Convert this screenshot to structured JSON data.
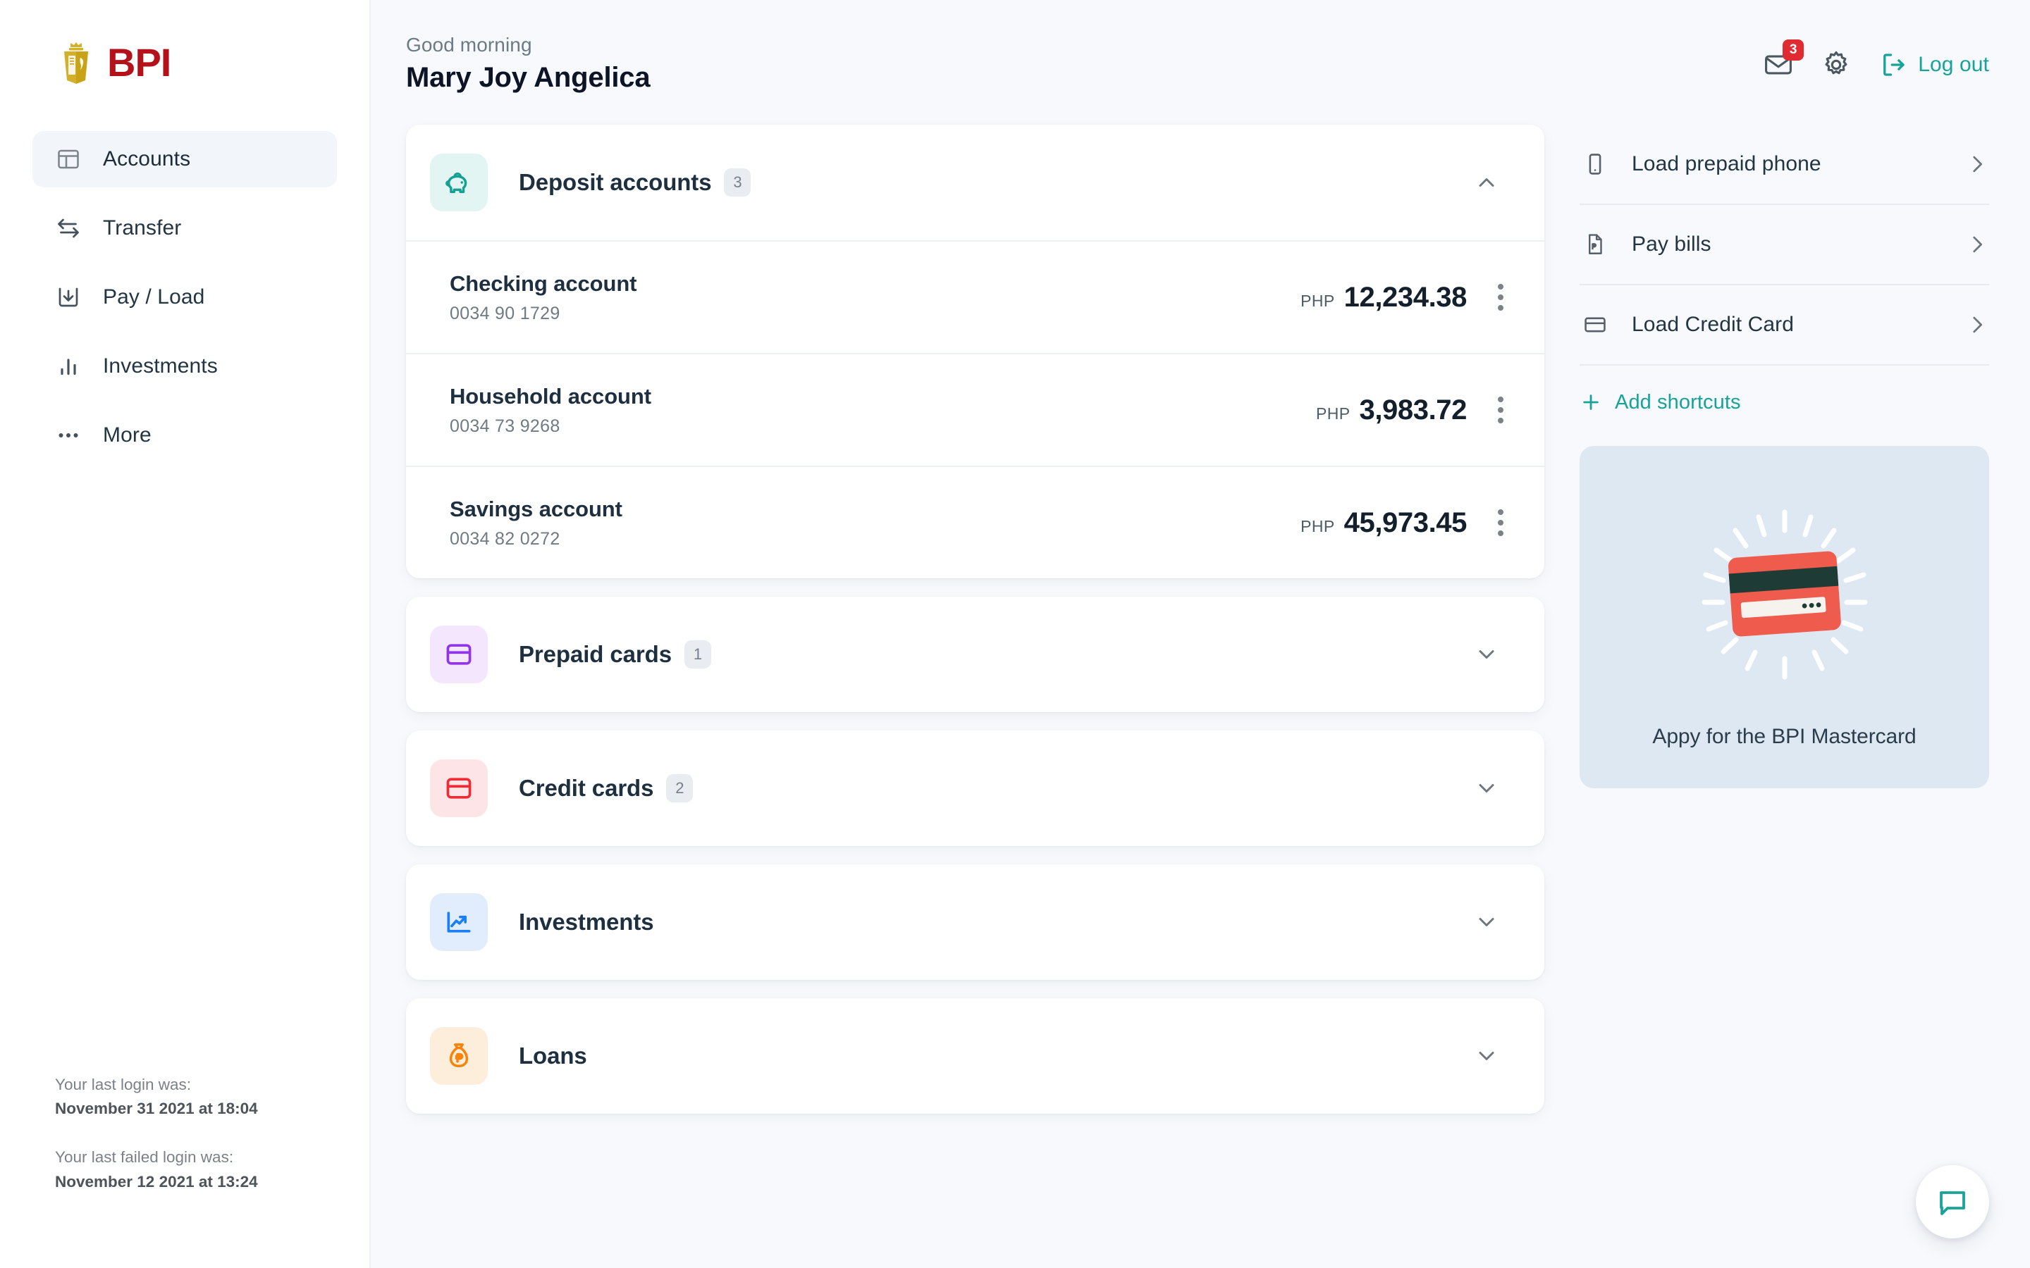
{
  "brand": {
    "name": "BPI",
    "logo_color": "#b4111b",
    "crest_color": "#d4af2a"
  },
  "sidebar": {
    "items": [
      {
        "label": "Accounts",
        "icon": "layout-icon",
        "active": true
      },
      {
        "label": "Transfer",
        "icon": "transfer-icon",
        "active": false
      },
      {
        "label": "Pay / Load",
        "icon": "download-box-icon",
        "active": false
      },
      {
        "label": "Investments",
        "icon": "bar-chart-icon",
        "active": false
      },
      {
        "label": "More",
        "icon": "ellipsis-icon",
        "active": false
      }
    ],
    "login_info": {
      "last_login_label": "Your last login was:",
      "last_login_value": "November 31 2021 at 18:04",
      "last_failed_label": "Your last failed login was:",
      "last_failed_value": "November 12 2021 at 13:24"
    }
  },
  "header": {
    "greeting": "Good morning",
    "user_name": "Mary Joy Angelica",
    "mail_badge_count": "3",
    "logout_label": "Log out",
    "accent_color": "#17a399",
    "badge_color": "#e02b33"
  },
  "sections": [
    {
      "title": "Deposit accounts",
      "count": "3",
      "icon": "piggy-bank-icon",
      "icon_color": "#15a094",
      "icon_bg": "#e3f5f2",
      "expanded": true,
      "accounts": [
        {
          "name": "Checking account",
          "number": "0034 90 1729",
          "currency": "PHP",
          "amount": "12,234.38"
        },
        {
          "name": "Household account",
          "number": "0034 73 9268",
          "currency": "PHP",
          "amount": "3,983.72"
        },
        {
          "name": "Savings account",
          "number": "0034 82 0272",
          "currency": "PHP",
          "amount": "45,973.45"
        }
      ]
    },
    {
      "title": "Prepaid cards",
      "count": "1",
      "icon": "card-icon",
      "icon_color": "#9333ea",
      "icon_bg": "#f3e6fd",
      "expanded": false,
      "accounts": []
    },
    {
      "title": "Credit cards",
      "count": "2",
      "icon": "card-icon",
      "icon_color": "#ef2b35",
      "icon_bg": "#fde4e6",
      "expanded": false,
      "accounts": []
    },
    {
      "title": "Investments",
      "count": "",
      "icon": "trend-up-icon",
      "icon_color": "#1a7ef5",
      "icon_bg": "#e1edfd",
      "expanded": false,
      "accounts": []
    },
    {
      "title": "Loans",
      "count": "",
      "icon": "money-bag-icon",
      "icon_color": "#f98208",
      "icon_bg": "#fdeedb",
      "expanded": false,
      "accounts": []
    }
  ],
  "shortcuts": {
    "items": [
      {
        "label": "Load prepaid phone",
        "icon": "phone-icon"
      },
      {
        "label": "Pay bills",
        "icon": "bill-peso-icon"
      },
      {
        "label": "Load Credit Card",
        "icon": "credit-card-icon"
      }
    ],
    "add_label": "Add shortcuts"
  },
  "promo": {
    "text": "Appy for the BPI Mastercard",
    "bg_color": "#dde8f3",
    "card_color": "#ef5b4c",
    "stripe_color": "#1f3b35"
  },
  "chat": {
    "icon": "chat-bubble-icon",
    "color": "#17a399"
  }
}
